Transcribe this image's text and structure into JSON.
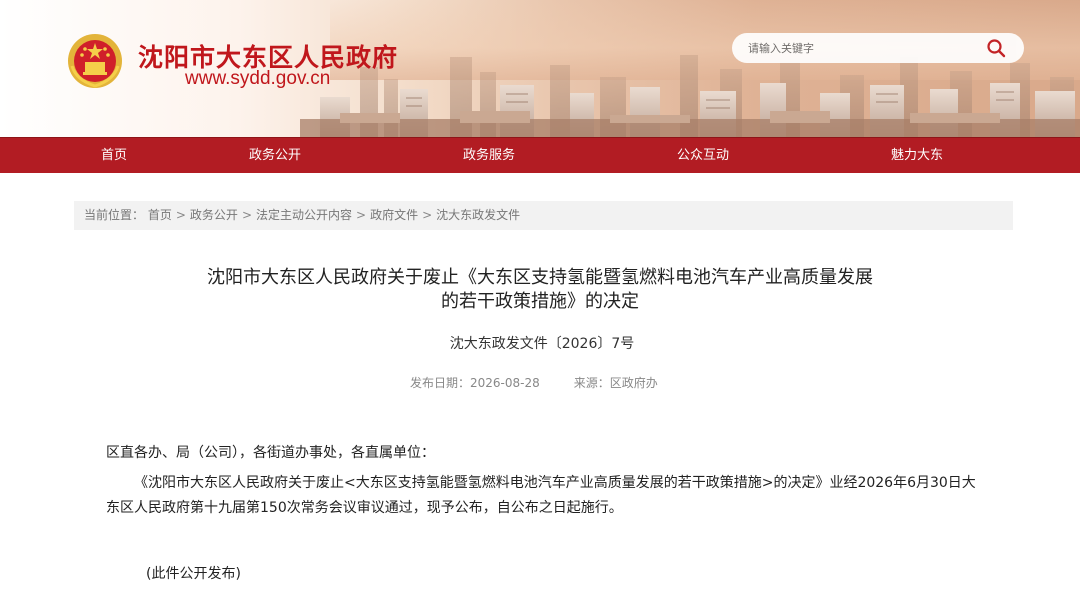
{
  "header": {
    "site_title": "沈阳市大东区人民政府",
    "site_url": "www.sydd.gov.cn",
    "search_placeholder": "请输入关键字"
  },
  "nav": {
    "items": [
      "首页",
      "政务公开",
      "政务服务",
      "公众互动",
      "魅力大东"
    ]
  },
  "breadcrumb": {
    "prefix": "当前位置：",
    "items": [
      "首页",
      "政务公开",
      "法定主动公开内容",
      "政府文件",
      "沈大东政发文件"
    ],
    "separator": ">"
  },
  "article": {
    "title_line1": "沈阳市大东区人民政府关于废止《大东区支持氢能暨氢燃料电池汽车产业高质量发展",
    "title_line2": "的若干政策措施》的决定",
    "doc_number": "沈大东政发文件〔2026〕7号",
    "publish_date_label": "发布日期：",
    "publish_date": "2026-08-28",
    "source_label": "来源：",
    "source": "区政府办",
    "salutation": "区直各办、局（公司），各街道办事处，各直属单位：",
    "paragraph": "《沈阳市大东区人民政府关于废止<大东区支持氢能暨氢燃料电池汽车产业高质量发展的若干政策措施>的决定》业经2026年6月30日大东区人民政府第十九届第150次常务会议审议通过，现予公布，自公布之日起施行。",
    "closing": "(此件公开发布)"
  },
  "colors": {
    "brand_red": "#b21c23",
    "title_red": "#c0171c",
    "breadcrumb_bg": "#f2f2f2"
  },
  "icons": {
    "emblem": "national-emblem-icon",
    "search": "search-icon"
  }
}
